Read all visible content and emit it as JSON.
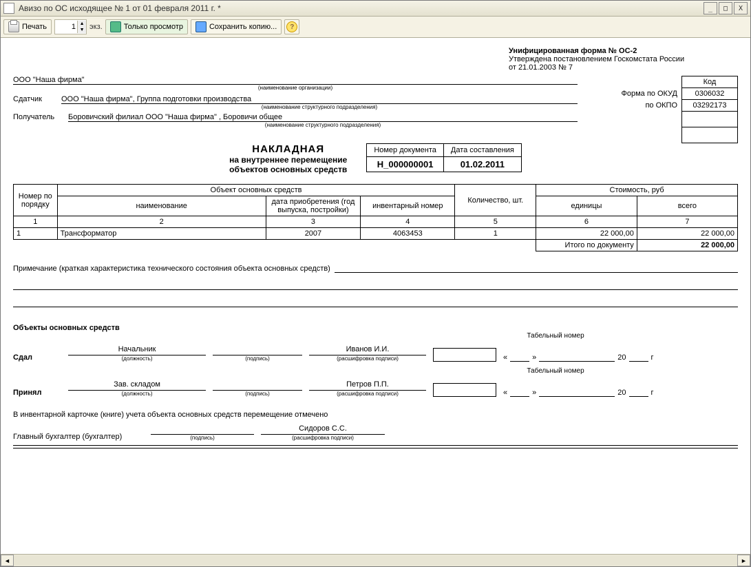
{
  "window": {
    "title": "Авизо по ОС исходящее № 1 от 01 февраля 2011 г. *"
  },
  "toolbar": {
    "print": "Печать",
    "copies": "1",
    "copies_unit": "экз.",
    "preview": "Только просмотр",
    "save": "Сохранить копию...",
    "help": "?"
  },
  "header": {
    "form_title": "Унифицированная форма № ОС-2",
    "approved": "Утверждена постановлением Госкомстата России",
    "approved_date": "от 21.01.2003 № 7",
    "code_caption": "Код",
    "okud_label": "Форма по ОКУД",
    "okud": "0306032",
    "okpo_label": "по ОКПО",
    "okpo": "03292173"
  },
  "org": {
    "name": "ООО \"Наша фирма\"",
    "name_note": "(наименование организации)",
    "sender_label": "Сдатчик",
    "sender": "ООО \"Наша фирма\",   Группа подготовки производства",
    "sender_note": "(наименование структурного подразделения)",
    "receiver_label": "Получатель",
    "receiver": "Боровичский филиал ООО \"Наша фирма\" ,   Боровичи общее",
    "receiver_note": "(наименование структурного подразделения)"
  },
  "doc": {
    "title1": "НАКЛАДНАЯ",
    "title2": "на внутреннее перемещение",
    "title3": "объектов основных средств",
    "num_label": "Номер документа",
    "date_label": "Дата составления",
    "num": "Н_000000001",
    "date": "01.02.2011"
  },
  "table": {
    "col_num": "Номер по порядку",
    "col_obj": "Объект основных средств",
    "col_name": "наименование",
    "col_acq": "дата приобретения (год выпуска, постройки)",
    "col_inv": "инвентарный номер",
    "col_qty": "Количество, шт.",
    "col_cost": "Стоимость, руб",
    "col_unit": "единицы",
    "col_total": "всего",
    "h1": "1",
    "h2": "2",
    "h3": "3",
    "h4": "4",
    "h5": "5",
    "h6": "6",
    "h7": "7",
    "rows": [
      {
        "n": "1",
        "name": "Трансформатор",
        "year": "2007",
        "inv": "4063453",
        "qty": "1",
        "unit": "22 000,00",
        "total": "22 000,00"
      }
    ],
    "total_label": "Итого по документу",
    "total_sum": "22 000,00"
  },
  "note": {
    "label": "Примечание (краткая характеристика технического состояния объекта основных средств)"
  },
  "assets_header": "Объекты основных средств",
  "sig": {
    "tabnum_cap": "Табельный номер",
    "gave_label": "Сдал",
    "gave_pos": "Начальник",
    "gave_name": "Иванов И.И.",
    "took_label": "Принял",
    "took_pos": "Зав. складом",
    "took_name": "Петров П.П.",
    "pos_note": "(должность)",
    "sign_note": "(подпись)",
    "decode_note": "(расшифровка подписи)",
    "date_open": "«",
    "date_mid": "»",
    "date_year": "20",
    "date_g": "г"
  },
  "footer": {
    "inv_card": "В инвентарной карточке (книге) учета объекта основных средств перемещение отмечено",
    "chief_label": "Главный бухгалтер (бухгалтер)",
    "chief_name": "Сидоров С.С."
  }
}
